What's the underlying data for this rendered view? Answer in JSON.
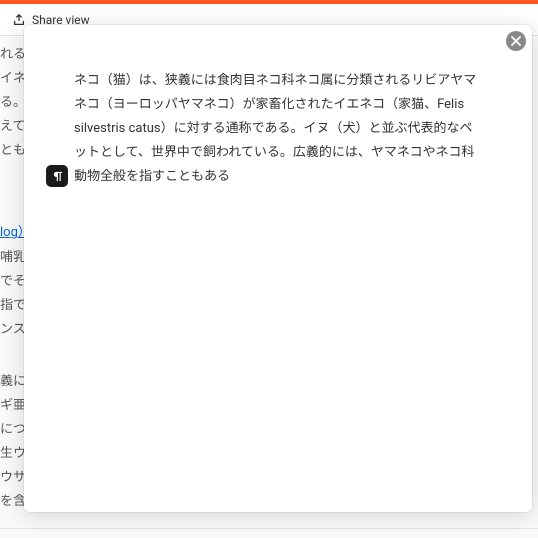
{
  "header": {
    "share_label": "Share view"
  },
  "background": {
    "left": {
      "line1": "れる",
      "line2": "イネ",
      "line3": "る。イ",
      "line4": "えて",
      "line5": "とも",
      "link": "log）",
      "line6": "哺乳類",
      "line7": "でそれ",
      "line8": "指で、「",
      "line9": "ンス語通",
      "line10": "義には",
      "line11": "ギ亜科",
      "line12": "につい",
      "line13": "生ウサ",
      "line14": "ウサギ",
      "line15": "を含む"
    }
  },
  "modal": {
    "text": "ネコ（猫）は、狭義には食肉目ネコ科ネコ属に分類されるリビアヤマネコ（ヨーロッパヤマネコ）が家畜化されたイエネコ（家猫、Felis silvestris catus）に対する通称である。イヌ（犬）と並ぶ代表的なペットとして、世界中で飼われている。広義的には、ヤマネコやネコ科動物全般を指すこともある"
  }
}
